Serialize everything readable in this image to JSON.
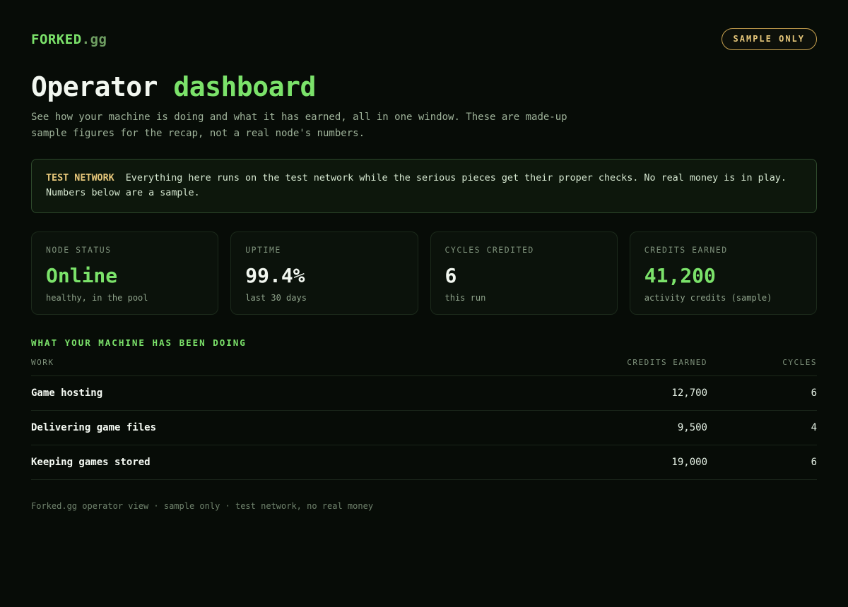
{
  "brand": {
    "name": "FORKED",
    "tld": ".gg"
  },
  "badge": "SAMPLE ONLY",
  "header": {
    "title_main": "Operator",
    "title_accent": "dashboard",
    "subtitle": "See how your machine is doing and what it has earned, all in one window. These are made-up sample figures for the recap, not a real node's numbers."
  },
  "notice": {
    "tag": "TEST NETWORK",
    "text": "Everything here runs on the test network while the serious pieces get their proper checks. No real money is in play. Numbers below are a sample."
  },
  "stats": [
    {
      "label": "NODE STATUS",
      "value": "Online",
      "sub": "healthy, in the pool",
      "accent": "#7be26a"
    },
    {
      "label": "UPTIME",
      "value": "99.4%",
      "sub": "last 30 days",
      "accent": "#f2f7f0"
    },
    {
      "label": "CYCLES CREDITED",
      "value": "6",
      "sub": "this run",
      "accent": "#f2f7f0"
    },
    {
      "label": "CREDITS EARNED",
      "value": "41,200",
      "sub": "activity credits (sample)",
      "accent": "#7be26a"
    }
  ],
  "work": {
    "section_title": "WHAT YOUR MACHINE HAS BEEN DOING",
    "columns": [
      "WORK",
      "CREDITS EARNED",
      "CYCLES"
    ],
    "rows": [
      {
        "work": "Game hosting",
        "credits": "12,700",
        "cycles": "6"
      },
      {
        "work": "Delivering game files",
        "credits": "9,500",
        "cycles": "4"
      },
      {
        "work": "Keeping games stored",
        "credits": "19,000",
        "cycles": "6"
      }
    ]
  },
  "footer": "Forked.gg operator view · sample only · test network, no real money",
  "colors": {
    "background": "#070c07",
    "accent_green": "#7be26a",
    "accent_gold": "#e6c77a"
  }
}
